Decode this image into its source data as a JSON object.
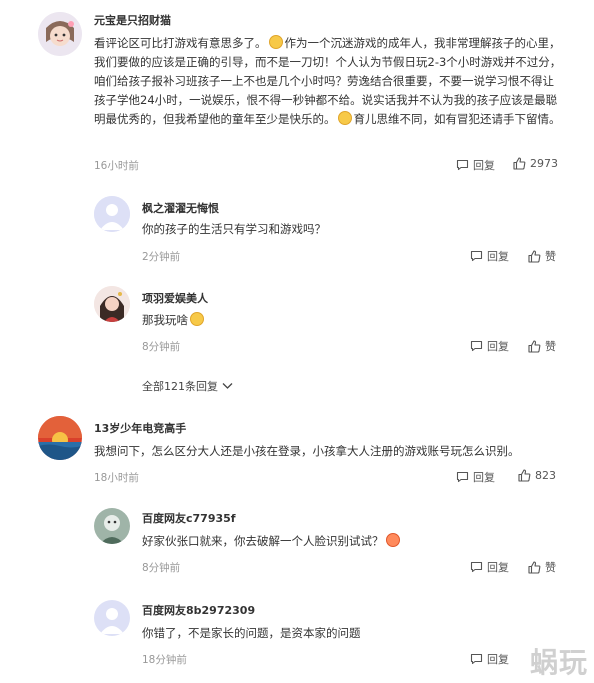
{
  "comments": [
    {
      "user": "元宝是只招财猫",
      "text1": "看评论区可比打游戏有意思多了。",
      "text2": "作为一个沉迷游戏的成年人，我非常理解孩子的心里，我们要做的应该是正确的引导，而不是一刀切！个人认为节假日玩2-3个小时游戏并不过分，咱们给孩子报补习班孩子一上不也是几个小时吗？劳逸结合很重要，不要一说学习恨不得让孩子学他24小时，一说娱乐，恨不得一秒钟都不给。说实话我并不认为我的孩子应该是最聪明最优秀的，但我希望他的童年至少是快乐的。",
      "text3": "育儿思维不同，如有冒犯还请手下留情。",
      "time": "16小时前",
      "reply": "回复",
      "likes": "2973"
    },
    {
      "user": "13岁少年电竞高手",
      "text": "我想问下，怎么区分大人还是小孩在登录，小孩拿大人注册的游戏账号玩怎么识别。",
      "time": "18小时前",
      "reply": "回复",
      "likes": "823"
    }
  ],
  "replies": [
    {
      "user": "枫之濯濯无悔恨",
      "text": "你的孩子的生活只有学习和游戏吗？",
      "time": "2分钟前",
      "reply": "回复",
      "like": "赞"
    },
    {
      "user": "项羽爱娱美人",
      "text": "那我玩啥",
      "time": "8分钟前",
      "reply": "回复",
      "like": "赞"
    },
    {
      "user": "百度网友c77935f",
      "text": "好家伙张口就来，你去破解一个人脸识别试试？",
      "time": "8分钟前",
      "reply": "回复",
      "like": "赞"
    },
    {
      "user": "百度网友8b2972309",
      "text": "你错了，不是家长的问题，是资本家的问题",
      "time": "18分钟前",
      "reply": "回复",
      "like": "赞"
    }
  ],
  "more_replies": "全部121条回复",
  "watermark": "蜗玩"
}
